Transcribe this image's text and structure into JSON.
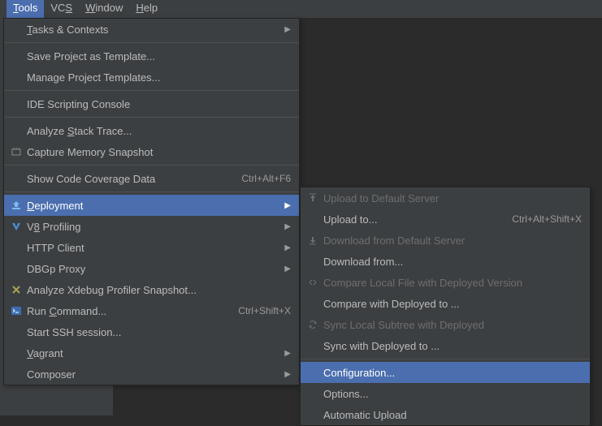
{
  "menubar": {
    "tools": "Tools",
    "vcs": "VCS",
    "window": "Window",
    "help": "Help"
  },
  "tools_menu": {
    "tasks": "Tasks & Contexts",
    "save_tpl": "Save Project as Template...",
    "manage_tpl": "Manage Project Templates...",
    "ide_console": "IDE Scripting Console",
    "analyze_stack": "Analyze Stack Trace...",
    "capture_mem": "Capture Memory Snapshot",
    "coverage": "Show Code Coverage Data",
    "coverage_sc": "Ctrl+Alt+F6",
    "deployment": "Deployment",
    "v8": "V8 Profiling",
    "http": "HTTP Client",
    "dbgp": "DBGp Proxy",
    "xdebug": "Analyze Xdebug Profiler Snapshot...",
    "run_cmd": "Run Command...",
    "run_cmd_sc": "Ctrl+Shift+X",
    "ssh": "Start SSH session...",
    "vagrant": "Vagrant",
    "composer": "Composer"
  },
  "dep_menu": {
    "upload_default": "Upload to Default Server",
    "upload_to": "Upload to...",
    "upload_to_sc": "Ctrl+Alt+Shift+X",
    "download_default": "Download from Default Server",
    "download_from": "Download from...",
    "compare_local": "Compare Local File with Deployed Version",
    "compare_deployed": "Compare with Deployed to ...",
    "sync_local": "Sync Local Subtree with Deployed",
    "sync_deployed": "Sync with Deployed to ...",
    "configuration": "Configuration...",
    "options": "Options...",
    "auto_upload": "Automatic Upload"
  }
}
